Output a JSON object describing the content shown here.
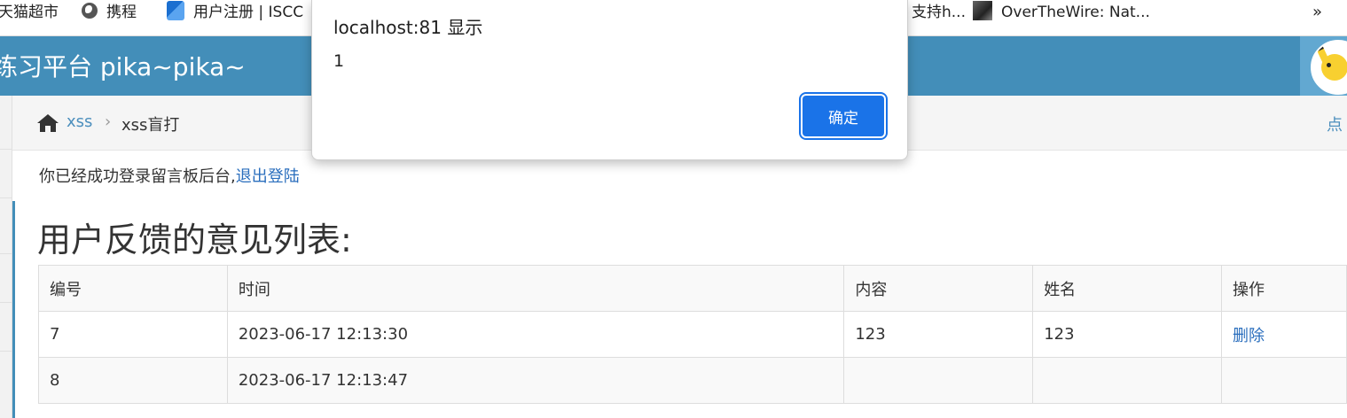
{
  "bookmarks": {
    "items": [
      {
        "label": "天猫超市",
        "icon": "none"
      },
      {
        "label": "携程",
        "icon": "globe-icon"
      },
      {
        "label": "用户注册 | ISCC",
        "icon": "blue-logo-icon"
      },
      {
        "label": "支持h...",
        "icon": "none"
      },
      {
        "label": "OverTheWire: Nat...",
        "icon": "cat-icon"
      }
    ],
    "overflow_label": "»"
  },
  "header": {
    "title": "练习平台 pika~pika~",
    "avatar": "pikachu-avatar"
  },
  "breadcrumbs": {
    "home_icon": "home-icon",
    "link": "xss",
    "separator": "›",
    "current": "xss盲打",
    "right_text": "点"
  },
  "content": {
    "login_text": "你已经成功登录留言板后台,",
    "logout_link": "退出登陆",
    "heading": "用户反馈的意见列表:"
  },
  "table": {
    "headers": [
      "编号",
      "时间",
      "内容",
      "姓名",
      "操作"
    ],
    "rows": [
      {
        "id": "7",
        "time": "2023-06-17 12:13:30",
        "content": "123",
        "name": "123",
        "action": "删除"
      },
      {
        "id": "8",
        "time": "2023-06-17 12:13:47",
        "content": "",
        "name": "",
        "action": ""
      }
    ]
  },
  "dialog": {
    "title": "localhost:81 显示",
    "message": "1",
    "ok_label": "确定"
  },
  "colors": {
    "header_bg": "#438eb9",
    "link": "#2a6ebd",
    "dialog_button": "#1a73e8"
  }
}
